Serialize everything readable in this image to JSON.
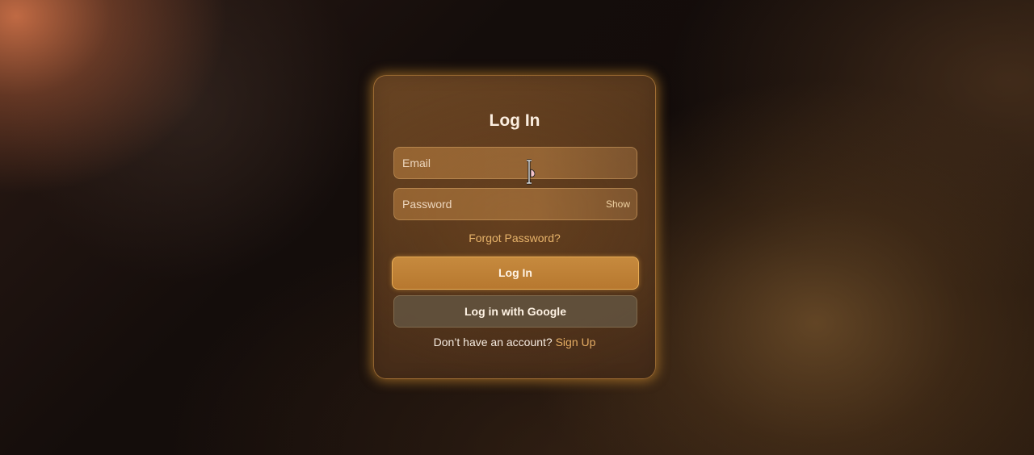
{
  "form": {
    "title": "Log In",
    "email_placeholder": "Email",
    "password_placeholder": "Password",
    "show_label": "Show",
    "forgot_label": "Forgot Password?",
    "login_button": "Log In",
    "google_button": "Log in with Google",
    "signup_prompt": "Don’t have an account?",
    "signup_link": "Sign Up"
  },
  "colors": {
    "accent": "#c68a3e",
    "link": "#e5ad64"
  },
  "icons": {
    "cursor": "text-cursor-icon"
  }
}
